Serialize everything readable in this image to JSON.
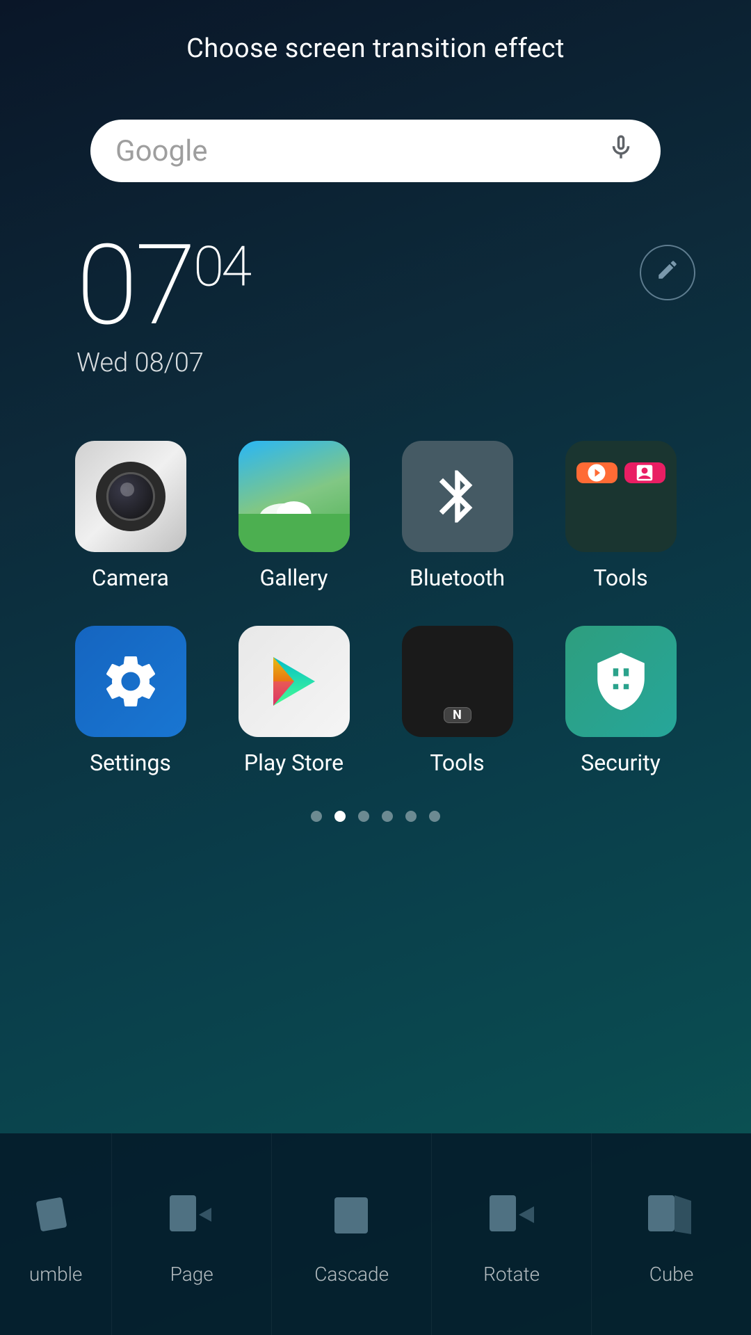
{
  "header": {
    "title": "Choose screen transition effect"
  },
  "search": {
    "placeholder": "Google",
    "mic_label": "microphone"
  },
  "clock": {
    "time": "07",
    "minutes": "04",
    "date": "Wed 08/07"
  },
  "apps_row1": [
    {
      "id": "camera",
      "label": "Camera"
    },
    {
      "id": "gallery",
      "label": "Gallery"
    },
    {
      "id": "bluetooth",
      "label": "Bluetooth"
    },
    {
      "id": "tools_folder",
      "label": "Tools"
    }
  ],
  "apps_row2": [
    {
      "id": "settings",
      "label": "Settings"
    },
    {
      "id": "play_store",
      "label": "Play Store"
    },
    {
      "id": "tools_app",
      "label": "Tools"
    },
    {
      "id": "security",
      "label": "Security"
    }
  ],
  "page_indicators": {
    "count": 6,
    "active": 1
  },
  "transitions": [
    {
      "id": "tumble",
      "label": "umble"
    },
    {
      "id": "page",
      "label": "Page"
    },
    {
      "id": "cascade",
      "label": "Cascade"
    },
    {
      "id": "rotate",
      "label": "Rotate"
    },
    {
      "id": "cube",
      "label": "Cube"
    }
  ]
}
